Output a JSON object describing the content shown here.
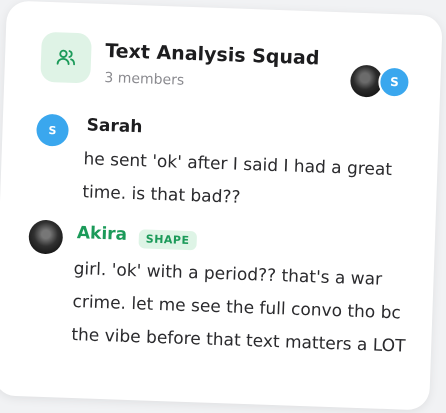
{
  "header": {
    "title": "Text Analysis Squad",
    "members": "3 members",
    "group_icon": "users-icon",
    "member_avatar_initial": "S"
  },
  "messages": [
    {
      "sender": "Sarah",
      "avatar_initial": "S",
      "text": "he sent 'ok' after I said I had a great time. is that bad??"
    },
    {
      "sender": "Akira",
      "badge": "SHAPE",
      "text": "girl. 'ok' with a period?? that's a war crime. let me see the full convo tho bc the vibe before that text matters a LOT"
    }
  ],
  "colors": {
    "accent_green": "#1b9a59",
    "avatar_blue": "#3aa7ee",
    "icon_bg": "#dff3e6"
  }
}
